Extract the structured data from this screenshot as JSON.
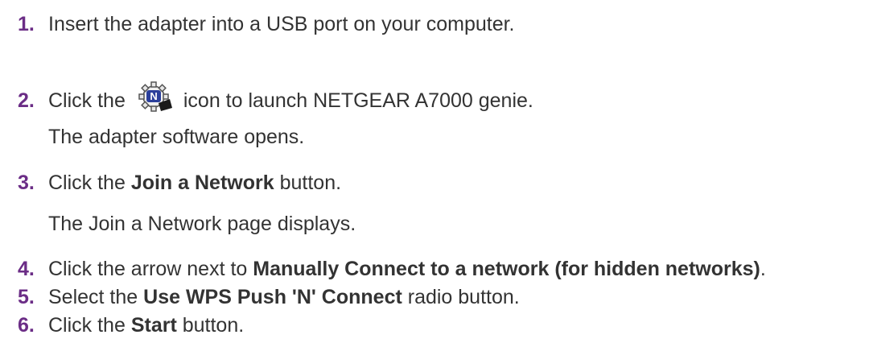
{
  "steps": [
    {
      "number": "1.",
      "text": "Insert the adapter into a USB port on your computer."
    },
    {
      "number": "2.",
      "before": "Click the",
      "icon": "netgear-genie-icon",
      "after": "icon to launch NETGEAR A7000 genie.",
      "result": "The adapter software opens."
    },
    {
      "number": "3.",
      "before": "Click the ",
      "bold": "Join a Network",
      "after": " button.",
      "result": "The Join a Network page displays."
    },
    {
      "number": "4.",
      "before": "Click the arrow next to ",
      "bold": "Manually Connect to a network (for hidden networks)",
      "after": "."
    },
    {
      "number": "5.",
      "before": "Select the ",
      "bold": "Use WPS Push 'N' Connect",
      "after": " radio button."
    },
    {
      "number": "6.",
      "before": "Click the ",
      "bold": "Start",
      "after": " button."
    }
  ],
  "colors": {
    "step_number": "#6b2d86",
    "text": "#333333",
    "icon_badge": "#2b3f9b"
  }
}
